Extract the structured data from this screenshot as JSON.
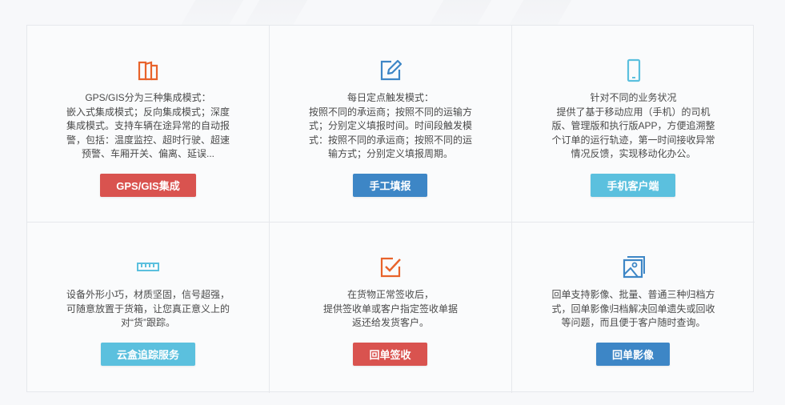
{
  "colors": {
    "red": "#d9534f",
    "blue": "#3d86c6",
    "cyan": "#5bc0de",
    "orange_icon": "#e8632b",
    "blue_icon": "#3d86c6",
    "cyan_icon": "#5bc0de"
  },
  "cards": [
    {
      "icon": "book-icon",
      "lines": [
        "GPS/GIS分为三种集成模式：",
        "嵌入式集成模式；反向集成模式；深度",
        "集成模式。支持车辆在途异常的自动报",
        "警，包括：温度监控、超时行驶、超速",
        "预警、车厢开关、偏离、延误..."
      ],
      "button": "GPS/GIS集成"
    },
    {
      "icon": "edit-icon",
      "lines": [
        "每日定点触发模式：",
        "按照不同的承运商；按照不同的运输方",
        "式；分别定义填报时间。时间段触发模",
        "式：按照不同的承运商；按照不同的运",
        "输方式；分别定义填报周期。"
      ],
      "button": "手工填报"
    },
    {
      "icon": "mobile-phone-icon",
      "lines": [
        "针对不同的业务状况",
        "提供了基于移动应用（手机）的司机",
        "版、管理版和执行版APP，方便追溯整",
        "个订单的运行轨迹，第一时间接收异常",
        "情况反馈，实现移动化办公。"
      ],
      "button": "手机客户端"
    },
    {
      "icon": "ruler-device-icon",
      "lines": [
        "设备外形小巧，材质坚固，信号超强，",
        "可随意放置于货箱，让您真正意义上的",
        "对“货”跟踪。"
      ],
      "button": "云盒追踪服务"
    },
    {
      "icon": "checkbox-icon",
      "lines": [
        "在货物正常签收后，",
        "提供签收单或客户指定签收单据",
        "返还给发货客户。"
      ],
      "button": "回单签收"
    },
    {
      "icon": "image-icon",
      "lines": [
        "回单支持影像、批量、普通三种归档方",
        "式，回单影像归档解决回单遗失或回收",
        "等问题，而且便于客户随时查询。"
      ],
      "button": "回单影像"
    }
  ]
}
